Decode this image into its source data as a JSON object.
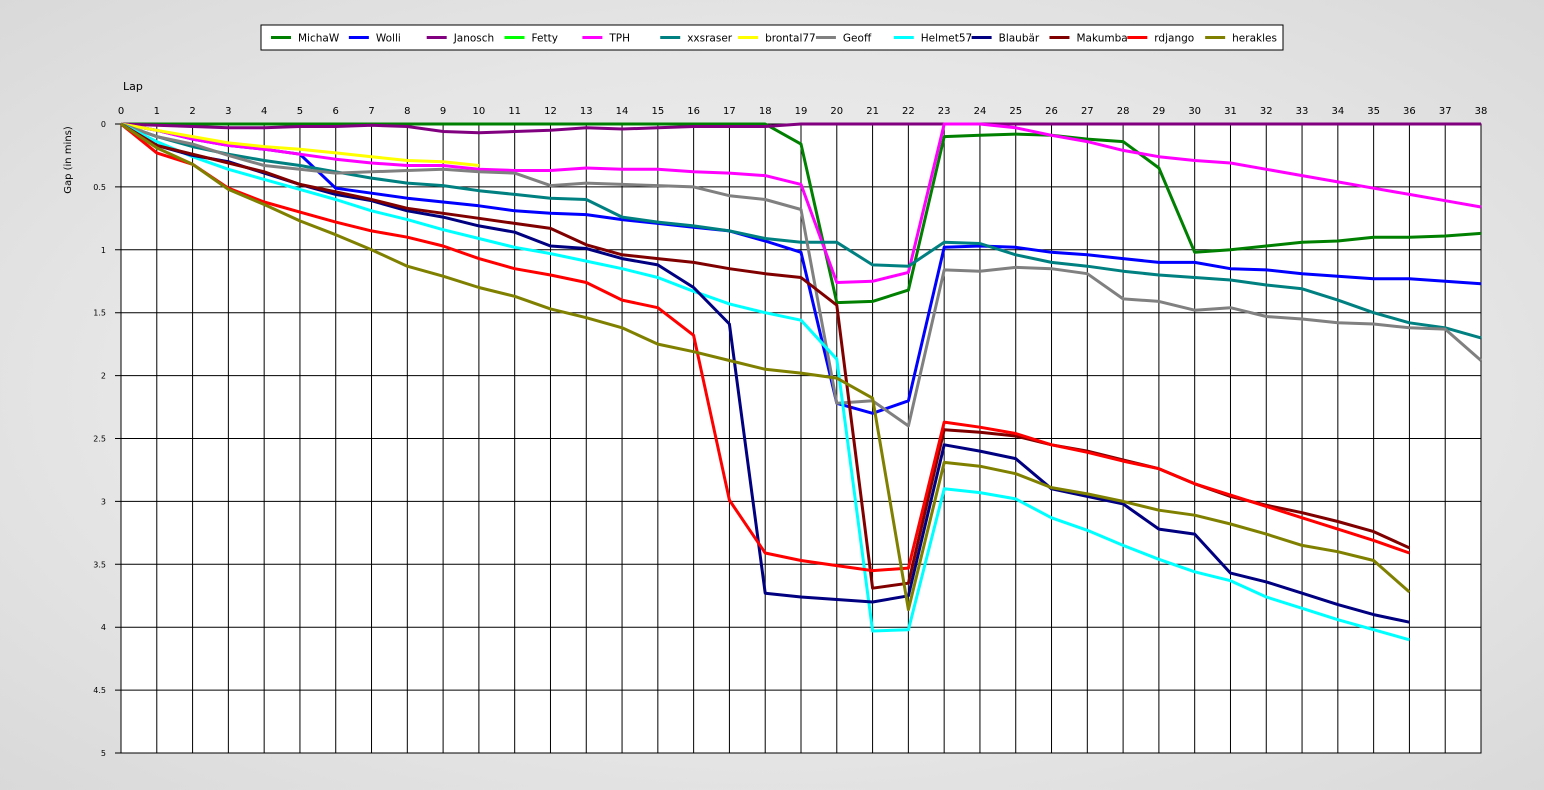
{
  "chart_data": {
    "type": "line",
    "xlabel": "Lap",
    "ylabel": "Gap (in mins)",
    "xlim": [
      0,
      38
    ],
    "ylim": [
      0,
      5
    ],
    "y_inverted": true,
    "grid": true,
    "legend_position": "top",
    "x_ticks": [
      0,
      1,
      2,
      3,
      4,
      5,
      6,
      7,
      8,
      9,
      10,
      11,
      12,
      13,
      14,
      15,
      16,
      17,
      18,
      19,
      20,
      21,
      22,
      23,
      24,
      25,
      26,
      27,
      28,
      29,
      30,
      31,
      32,
      33,
      34,
      35,
      36,
      37,
      38
    ],
    "y_ticks": [
      0,
      0.5,
      1,
      1.5,
      2,
      2.5,
      3,
      3.5,
      4,
      4.5,
      5
    ],
    "y_tick_labels": [
      "0",
      "0.5",
      "1",
      "1.5",
      "2",
      "2.5",
      "3",
      "3.5",
      "4",
      "4.5",
      "5"
    ],
    "series": [
      {
        "name": "MichaW",
        "color": "#008000",
        "values": [
          0,
          0,
          0,
          0,
          0,
          0,
          0,
          0,
          0,
          0,
          0,
          0,
          0,
          0,
          0,
          0,
          0,
          0,
          0,
          0.16,
          1.42,
          1.41,
          1.32,
          0.1,
          0.09,
          0.08,
          0.09,
          0.12,
          0.14,
          0.35,
          1.02,
          1.0,
          0.97,
          0.94,
          0.93,
          0.9,
          0.9,
          0.89,
          0.87
        ]
      },
      {
        "name": "Wolli",
        "color": "#0000ff",
        "values": [
          0,
          0.05,
          0.12,
          0.17,
          0.2,
          0.24,
          0.51,
          0.55,
          0.59,
          0.62,
          0.65,
          0.69,
          0.71,
          0.72,
          0.76,
          0.79,
          0.82,
          0.85,
          0.93,
          1.02,
          2.22,
          2.3,
          2.2,
          0.98,
          0.97,
          0.98,
          1.02,
          1.04,
          1.07,
          1.1,
          1.1,
          1.15,
          1.16,
          1.19,
          1.21,
          1.23,
          1.23,
          1.25,
          1.27
        ]
      },
      {
        "name": "Janosch",
        "color": "#800080",
        "values": [
          0,
          0.01,
          0.02,
          0.03,
          0.03,
          0.02,
          0.02,
          0.01,
          0.02,
          0.06,
          0.07,
          0.06,
          0.05,
          0.03,
          0.04,
          0.03,
          0.02,
          0.02,
          0.02,
          0,
          0,
          0,
          0,
          0,
          0,
          0,
          0,
          0,
          0,
          0,
          0,
          0,
          0,
          0,
          0,
          0,
          0,
          0,
          0
        ]
      },
      {
        "name": "Fetty",
        "color": "#00ff00",
        "values": []
      },
      {
        "name": "TPH",
        "color": "#ff00ff",
        "values": [
          0,
          0.05,
          0.12,
          0.17,
          0.2,
          0.24,
          0.28,
          0.31,
          0.33,
          0.33,
          0.36,
          0.37,
          0.37,
          0.35,
          0.36,
          0.36,
          0.38,
          0.39,
          0.41,
          0.48,
          1.26,
          1.25,
          1.18,
          0,
          0,
          0.03,
          0.09,
          0.14,
          0.21,
          0.26,
          0.29,
          0.31,
          0.36,
          0.41,
          0.46,
          0.51,
          0.56,
          0.61,
          0.66
        ]
      },
      {
        "name": "xxsraser",
        "color": "#008080",
        "values": [
          0,
          0.1,
          0.18,
          0.24,
          0.29,
          0.33,
          0.38,
          0.43,
          0.47,
          0.49,
          0.53,
          0.56,
          0.59,
          0.6,
          0.74,
          0.78,
          0.81,
          0.85,
          0.91,
          0.94,
          0.94,
          1.12,
          1.13,
          0.94,
          0.95,
          1.04,
          1.1,
          1.13,
          1.17,
          1.2,
          1.22,
          1.24,
          1.28,
          1.31,
          1.4,
          1.5,
          1.58,
          1.62,
          1.7
        ]
      },
      {
        "name": "brontal77",
        "color": "#ffff00",
        "values": [
          0,
          0.05,
          0.1,
          0.15,
          0.18,
          0.2,
          0.23,
          0.26,
          0.29,
          0.3,
          0.33
        ]
      },
      {
        "name": "Geoff",
        "color": "#808080",
        "values": [
          0,
          0.1,
          0.16,
          0.25,
          0.33,
          0.36,
          0.39,
          0.38,
          0.37,
          0.36,
          0.38,
          0.39,
          0.49,
          0.47,
          0.48,
          0.49,
          0.5,
          0.57,
          0.6,
          0.68,
          2.22,
          2.2,
          2.4,
          1.16,
          1.17,
          1.14,
          1.15,
          1.19,
          1.39,
          1.41,
          1.48,
          1.46,
          1.53,
          1.55,
          1.58,
          1.59,
          1.62,
          1.63,
          1.88
        ]
      },
      {
        "name": "Helmet57",
        "color": "#00ffff",
        "values": [
          0,
          0.14,
          0.26,
          0.36,
          0.44,
          0.52,
          0.6,
          0.69,
          0.76,
          0.84,
          0.91,
          0.98,
          1.03,
          1.09,
          1.15,
          1.22,
          1.33,
          1.43,
          1.5,
          1.56,
          1.87,
          4.03,
          4.02,
          2.9,
          2.93,
          2.98,
          3.13,
          3.23,
          3.35,
          3.46,
          3.56,
          3.63,
          3.76,
          3.85,
          3.94,
          4.02,
          4.1
        ]
      },
      {
        "name": "Blaubär",
        "color": "#000080",
        "values": [
          0,
          0.17,
          0.25,
          0.3,
          0.39,
          0.48,
          0.56,
          0.61,
          0.69,
          0.74,
          0.81,
          0.86,
          0.97,
          0.99,
          1.07,
          1.12,
          1.3,
          1.59,
          3.73,
          3.76,
          3.78,
          3.8,
          3.75,
          2.55,
          2.6,
          2.66,
          2.9,
          2.96,
          3.02,
          3.22,
          3.26,
          3.57,
          3.64,
          3.73,
          3.82,
          3.9,
          3.96
        ]
      },
      {
        "name": "Makumba",
        "color": "#800000",
        "values": [
          0,
          0.17,
          0.24,
          0.31,
          0.38,
          0.48,
          0.54,
          0.6,
          0.67,
          0.71,
          0.75,
          0.79,
          0.83,
          0.96,
          1.04,
          1.07,
          1.1,
          1.15,
          1.19,
          1.22,
          1.44,
          3.69,
          3.65,
          2.43,
          2.45,
          2.48,
          2.55,
          2.6,
          2.67,
          2.74,
          2.86,
          2.96,
          3.03,
          3.09,
          3.16,
          3.24,
          3.37
        ]
      },
      {
        "name": "rdjango",
        "color": "#ff0000",
        "values": [
          0,
          0.23,
          0.32,
          0.51,
          0.62,
          0.7,
          0.78,
          0.85,
          0.9,
          0.97,
          1.07,
          1.15,
          1.2,
          1.26,
          1.4,
          1.46,
          1.68,
          2.99,
          3.41,
          3.47,
          3.51,
          3.55,
          3.53,
          2.37,
          2.41,
          2.46,
          2.55,
          2.61,
          2.68,
          2.74,
          2.86,
          2.95,
          3.04,
          3.13,
          3.22,
          3.31,
          3.41
        ]
      },
      {
        "name": "herakles",
        "color": "#808000",
        "values": [
          0,
          0.19,
          0.32,
          0.52,
          0.64,
          0.77,
          0.88,
          1.0,
          1.13,
          1.21,
          1.3,
          1.37,
          1.47,
          1.54,
          1.62,
          1.75,
          1.81,
          1.88,
          1.95,
          1.98,
          2.02,
          2.18,
          3.86,
          2.69,
          2.72,
          2.78,
          2.89,
          2.94,
          3.0,
          3.07,
          3.11,
          3.18,
          3.26,
          3.35,
          3.4,
          3.47,
          3.72
        ]
      }
    ]
  }
}
